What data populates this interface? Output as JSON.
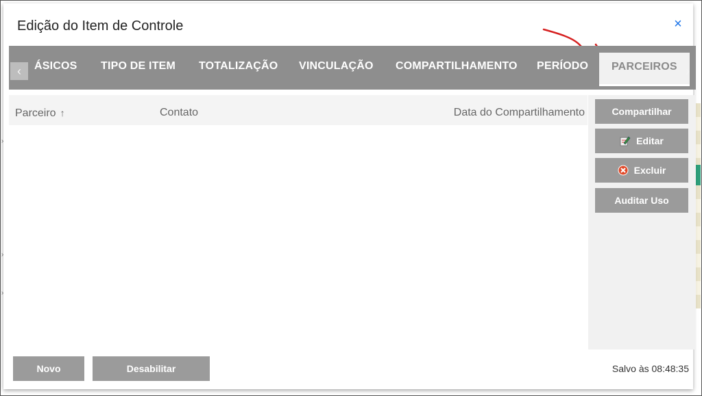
{
  "dialog": {
    "title": "Edição do Item de Controle",
    "close_glyph": "×"
  },
  "tabs": [
    {
      "label": "ÁSICOS",
      "active": false
    },
    {
      "label": "TIPO DE ITEM",
      "active": false
    },
    {
      "label": "TOTALIZAÇÃO",
      "active": false
    },
    {
      "label": "VINCULAÇÃO",
      "active": false
    },
    {
      "label": "COMPARTILHAMENTO",
      "active": false
    },
    {
      "label": "PERÍODO",
      "active": false
    },
    {
      "label": "PARCEIROS",
      "active": true
    }
  ],
  "tab_scroll": {
    "left_glyph": "‹",
    "right_glyph": "›"
  },
  "table": {
    "columns": [
      {
        "label": "Parceiro",
        "sort_glyph": "↑"
      },
      {
        "label": "Contato"
      },
      {
        "label": "Data do Compartilhamento"
      }
    ],
    "rows": []
  },
  "side_actions": {
    "share": "Compartilhar",
    "edit": "Editar",
    "delete": "Excluir",
    "audit": "Auditar Uso"
  },
  "footer": {
    "new": "Novo",
    "disable": "Desabilitar",
    "saved_status": "Salvo às 08:48:35"
  },
  "colors": {
    "tabbar_bg": "#8e8e8e",
    "button_bg": "#9b9b9b",
    "close_blue": "#1a73e8",
    "annotation_red": "#d62020"
  },
  "icons": {
    "edit": "edit-pencil-icon",
    "delete": "delete-x-circle-icon",
    "close": "close-icon"
  }
}
